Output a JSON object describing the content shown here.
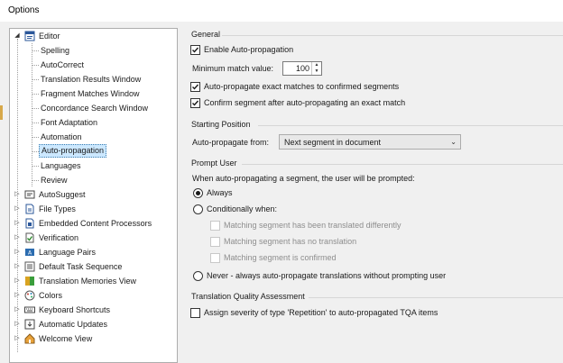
{
  "window": {
    "title": "Options"
  },
  "tree": {
    "editor": {
      "label": "Editor"
    },
    "editor_children": [
      {
        "label": "Spelling"
      },
      {
        "label": "AutoCorrect"
      },
      {
        "label": "Translation Results Window"
      },
      {
        "label": "Fragment Matches Window"
      },
      {
        "label": "Concordance Search Window"
      },
      {
        "label": "Font Adaptation"
      },
      {
        "label": "Automation"
      },
      {
        "label": "Auto-propagation",
        "selected": true
      },
      {
        "label": "Languages"
      },
      {
        "label": "Review"
      }
    ],
    "top_nodes": [
      {
        "label": "AutoSuggest",
        "icon": "autosuggest-icon"
      },
      {
        "label": "File Types",
        "icon": "file-types-icon"
      },
      {
        "label": "Embedded Content Processors",
        "icon": "embedded-content-icon"
      },
      {
        "label": "Verification",
        "icon": "verification-icon"
      },
      {
        "label": "Language Pairs",
        "icon": "language-pairs-icon"
      },
      {
        "label": "Default Task Sequence",
        "icon": "task-sequence-icon"
      },
      {
        "label": "Translation Memories View",
        "icon": "translation-memories-icon"
      },
      {
        "label": "Colors",
        "icon": "palette-icon"
      },
      {
        "label": "Keyboard Shortcuts",
        "icon": "keyboard-icon"
      },
      {
        "label": "Automatic Updates",
        "icon": "updates-icon"
      },
      {
        "label": "Welcome View",
        "icon": "home-icon"
      }
    ]
  },
  "general": {
    "title": "General",
    "enable_label": "Enable Auto-propagation",
    "enable_checked": true,
    "min_match_label": "Minimum match value:",
    "min_match_value": "100",
    "exact_label": "Auto-propagate exact matches to confirmed segments",
    "exact_checked": true,
    "confirm_label": "Confirm segment after auto-propagating an exact match",
    "confirm_checked": true
  },
  "starting_position": {
    "title": "Starting Position",
    "from_label": "Auto-propagate from:",
    "from_value": "Next segment in document"
  },
  "prompt_user": {
    "title": "Prompt User",
    "description": "When auto-propagating a segment, the user will be prompted:",
    "always_label": "Always",
    "conditionally_label": "Conditionally when:",
    "conditions": [
      "Matching segment has been translated differently",
      "Matching segment has no translation",
      "Matching segment is confirmed"
    ],
    "never_label": "Never - always auto-propagate translations without prompting user",
    "selected": "Always"
  },
  "tqa": {
    "title": "Translation Quality Assessment",
    "assign_label": "Assign severity of type 'Repetition' to auto-propagated TQA items",
    "assign_checked": false
  }
}
